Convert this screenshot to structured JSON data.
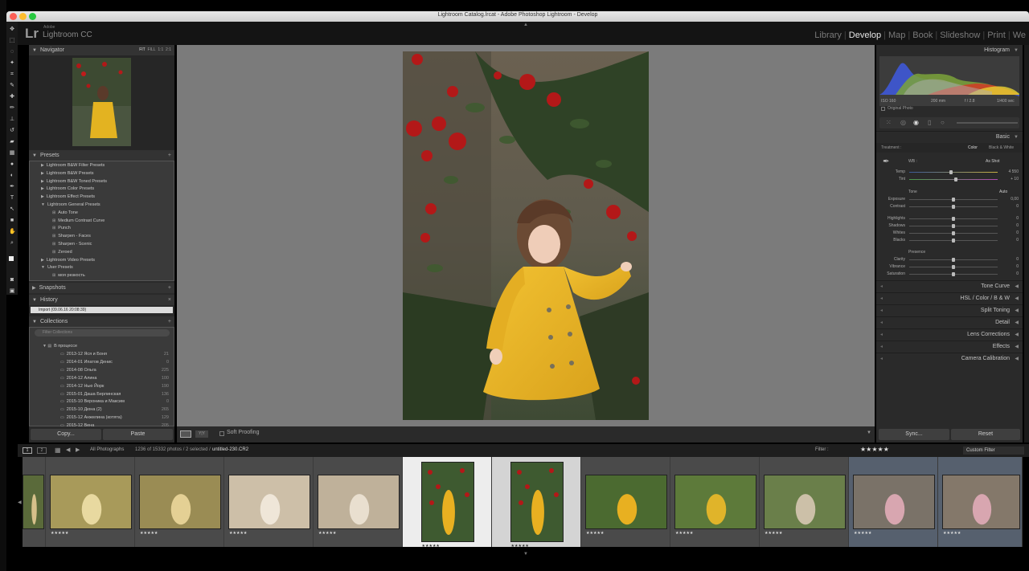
{
  "window": {
    "title": "Lightroom Catalog.lrcat - Adobe Photoshop Lightroom - Develop"
  },
  "identity": {
    "logo": "Lr",
    "adobe": "Adobe",
    "product": "Lightroom CC"
  },
  "modules": [
    "Library",
    "Develop",
    "Map",
    "Book",
    "Slideshow",
    "Print",
    "We"
  ],
  "active_module": "Develop",
  "navigator": {
    "title": "Navigator",
    "zoom_options": [
      "FIT",
      "FILL",
      "1:1",
      "2:1"
    ]
  },
  "presets": {
    "title": "Presets",
    "items": [
      {
        "label": "Lightroom B&W Filter Presets",
        "type": "folder"
      },
      {
        "label": "Lightroom B&W Presets",
        "type": "folder"
      },
      {
        "label": "Lightroom B&W Toned Presets",
        "type": "folder"
      },
      {
        "label": "Lightroom Color Presets",
        "type": "folder"
      },
      {
        "label": "Lightroom Effect Presets",
        "type": "folder"
      },
      {
        "label": "Lightroom General Presets",
        "type": "open"
      },
      {
        "label": "Auto Tone",
        "type": "preset"
      },
      {
        "label": "Medium Contrast Curve",
        "type": "preset"
      },
      {
        "label": "Punch",
        "type": "preset"
      },
      {
        "label": "Sharpen - Faces",
        "type": "preset"
      },
      {
        "label": "Sharpen - Scenic",
        "type": "preset"
      },
      {
        "label": "Zeroed",
        "type": "preset"
      },
      {
        "label": "Lightroom Video Presets",
        "type": "folder"
      },
      {
        "label": "User Presets",
        "type": "open"
      },
      {
        "label": "моя резкость",
        "type": "preset"
      }
    ]
  },
  "snapshots": {
    "title": "Snapshots"
  },
  "history": {
    "title": "History",
    "items": [
      "Import (09.06.16 20:08:39)"
    ]
  },
  "collections": {
    "title": "Collections",
    "filter_placeholder": "Filter Collections",
    "set": "В процессе",
    "items": [
      {
        "name": "2013-12 Яся и Боня",
        "count": "21"
      },
      {
        "name": "2014-01 Ипатов Денис",
        "count": "0"
      },
      {
        "name": "2014-08 Ольга",
        "count": "225"
      },
      {
        "name": "2014-12 Алина",
        "count": "100"
      },
      {
        "name": "2014-12 Нью Йорк",
        "count": "190"
      },
      {
        "name": "2015-01 Даша Берлинская",
        "count": "136"
      },
      {
        "name": "2015-10 Вероника и Максим",
        "count": "0"
      },
      {
        "name": "2015-10 Дюна (2)",
        "count": "265"
      },
      {
        "name": "2015-12 Анжелина (котята)",
        "count": "129"
      },
      {
        "name": "2015-12 Вена",
        "count": "205"
      }
    ]
  },
  "left_buttons": {
    "copy": "Copy...",
    "paste": "Paste"
  },
  "toolbar": {
    "soft_proofing": "Soft Proofing"
  },
  "histogram": {
    "title": "Histogram",
    "iso": "ISO 160",
    "focal": "200 mm",
    "aperture": "f / 2.8",
    "shutter": "1/400 sec",
    "original_photo": "Original Photo"
  },
  "basic": {
    "title": "Basic",
    "treatment_label": "Treatment :",
    "treatment_color": "Color",
    "treatment_bw": "Black & White",
    "wb_label": "WB :",
    "wb_value": "As Shot",
    "temp": {
      "label": "Temp",
      "value": "4 550",
      "pos": 0.47
    },
    "tint": {
      "label": "Tint",
      "value": "+ 10",
      "pos": 0.53
    },
    "tone_label": "Tone",
    "tone_auto": "Auto",
    "sliders": [
      {
        "label": "Exposure",
        "value": "0,00",
        "pos": 0.5
      },
      {
        "label": "Contrast",
        "value": "0",
        "pos": 0.5
      },
      {
        "label": "Highlights",
        "value": "0",
        "pos": 0.5
      },
      {
        "label": "Shadows",
        "value": "0",
        "pos": 0.5
      },
      {
        "label": "Whites",
        "value": "0",
        "pos": 0.5
      },
      {
        "label": "Blacks",
        "value": "0",
        "pos": 0.5
      }
    ],
    "presence_label": "Presence",
    "presence": [
      {
        "label": "Clarity",
        "value": "0",
        "pos": 0.5
      },
      {
        "label": "Vibrance",
        "value": "0",
        "pos": 0.5
      },
      {
        "label": "Saturation",
        "value": "0",
        "pos": 0.5
      }
    ]
  },
  "right_sections": [
    "Tone Curve",
    "HSL / Color / B & W",
    "Split Toning",
    "Detail",
    "Lens Corrections",
    "Effects",
    "Camera Calibration"
  ],
  "right_buttons": {
    "sync": "Sync...",
    "reset": "Reset"
  },
  "filmstrip": {
    "source": "All Photographs",
    "count_text": "1236 of 15332 photos / 2 selected /",
    "filename": "untitled-230.CR2",
    "filter_label": "Filter :",
    "filter_stars": "★★★★★",
    "custom_filter": "Custom Filter",
    "stars": "★★★★★"
  },
  "colors": {
    "accent": "#e6e6e6",
    "panel": "#2a2a2a",
    "canvas": "#7b7b7b"
  }
}
